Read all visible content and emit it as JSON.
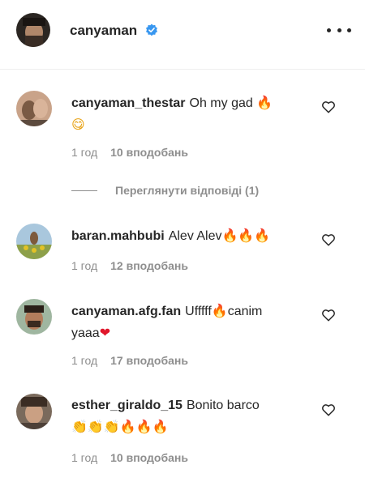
{
  "header": {
    "username": "canyaman",
    "verified_icon": "verified-badge-icon",
    "more_icon": "more-options-icon"
  },
  "colors": {
    "verified": "#3897f0",
    "secondary_text": "#8e8e8e",
    "primary_text": "#262626"
  },
  "comments": [
    {
      "user": "canyaman_thestar",
      "text": "Oh my gad",
      "emojis": "🔥",
      "line2": "😋",
      "time": "1 год",
      "likes": "10 вподобань"
    },
    {
      "user": "baran.mahbubi",
      "text": "Alev Alev",
      "emojis": "🔥🔥🔥",
      "time": "1 год",
      "likes": "12 вподобань"
    },
    {
      "user": "canyaman.afg.fan",
      "text": "Ufffff",
      "emojis": "🔥",
      "text_after": "canim",
      "line2": "yaaa",
      "line2_emoji": "❤",
      "time": "1 год",
      "likes": "17 вподобань"
    },
    {
      "user": "esther_giraldo_15",
      "text": "Bonito barco",
      "line2_hands": "👏👏👏",
      "line2_fire": "🔥🔥🔥",
      "time": "1 год",
      "likes": "10 вподобань"
    }
  ],
  "replies_toggle": "Переглянути відповіді (1)",
  "like_icon": "heart-outline-icon"
}
